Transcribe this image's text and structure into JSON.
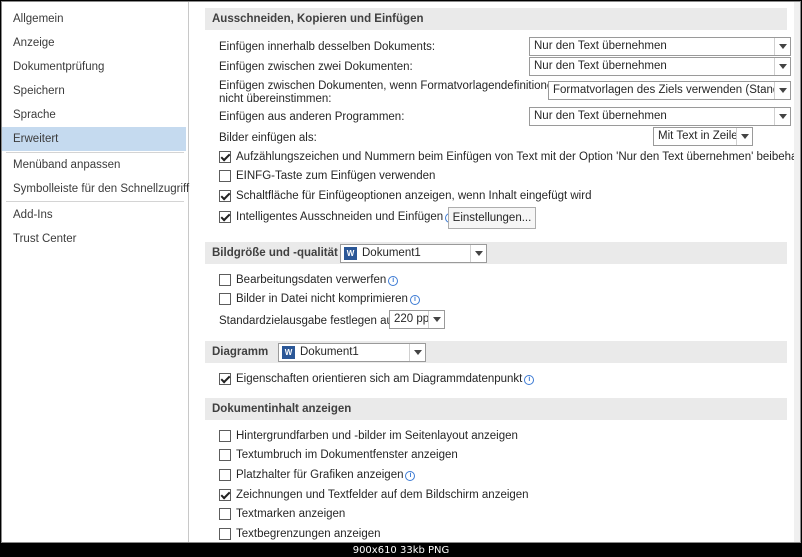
{
  "sidebar": {
    "items": [
      {
        "label": "Allgemein"
      },
      {
        "label": "Anzeige"
      },
      {
        "label": "Dokumentprüfung"
      },
      {
        "label": "Speichern"
      },
      {
        "label": "Sprache"
      },
      {
        "label": "Erweitert"
      },
      {
        "label": "Menüband anpassen"
      },
      {
        "label": "Symbolleiste für den Schnellzugriff"
      },
      {
        "label": "Add-Ins"
      },
      {
        "label": "Trust Center"
      }
    ],
    "selected": "Erweitert"
  },
  "cutcopy": {
    "title": "Ausschneiden, Kopieren und Einfügen",
    "rows": [
      {
        "label": "Einfügen innerhalb desselben Dokuments:",
        "value": "Nur den Text übernehmen"
      },
      {
        "label": "Einfügen zwischen zwei Dokumenten:",
        "value": "Nur den Text übernehmen"
      },
      {
        "label_line1": "Einfügen zwischen Dokumenten, wenn Formatvorlagendefinitionen",
        "label_line2": "nicht übereinstimmen:",
        "value": "Formatvorlagen des Ziels verwenden (Standard)"
      },
      {
        "label": "Einfügen aus anderen Programmen:",
        "value": "Nur den Text übernehmen"
      }
    ],
    "images_label": "Bilder einfügen als:",
    "images_value": "Mit Text in Zeile",
    "checks": [
      {
        "label": "Aufzählungszeichen und Nummern beim Einfügen von Text mit der Option 'Nur den Text übernehmen' beibehalten",
        "checked": true
      },
      {
        "label": "EINFG-Taste zum Einfügen verwenden",
        "checked": false
      },
      {
        "label": "Schaltfläche für Einfügeoptionen anzeigen, wenn Inhalt eingefügt wird",
        "checked": true
      },
      {
        "label": "Intelligentes Ausschneiden und Einfügen",
        "checked": true
      }
    ],
    "settings_button": "Einstellungen..."
  },
  "image": {
    "title": "Bildgröße und -qualität",
    "doc": "Dokument1",
    "checks": [
      {
        "label": "Bearbeitungsdaten verwerfen",
        "checked": false
      },
      {
        "label": "Bilder in Datei nicht komprimieren",
        "checked": false
      }
    ],
    "ppi_label": "Standardzielausgabe festlegen auf:",
    "ppi_value": "220 ppi"
  },
  "chart": {
    "title": "Diagramm",
    "doc": "Dokument1",
    "checks": [
      {
        "label": "Eigenschaften orientieren sich am Diagrammdatenpunkt",
        "checked": true
      }
    ]
  },
  "content": {
    "title": "Dokumentinhalt anzeigen",
    "checks": [
      {
        "label": "Hintergrundfarben und -bilder im Seitenlayout anzeigen",
        "checked": false
      },
      {
        "label": "Textumbruch im Dokumentfenster anzeigen",
        "checked": false
      },
      {
        "label": "Platzhalter für Grafiken anzeigen",
        "checked": false
      },
      {
        "label": "Zeichnungen und Textfelder auf dem Bildschirm anzeigen",
        "checked": true
      },
      {
        "label": "Textmarken anzeigen",
        "checked": false
      },
      {
        "label": "Textbegrenzungen anzeigen",
        "checked": false
      }
    ]
  },
  "icons": {
    "info": "info-icon",
    "word_doc": "word-document-icon",
    "dropdown": "chevron-down-icon"
  },
  "doc_icon_letter": "W",
  "info_glyph": "i",
  "footer": "900x610  33kb  PNG"
}
